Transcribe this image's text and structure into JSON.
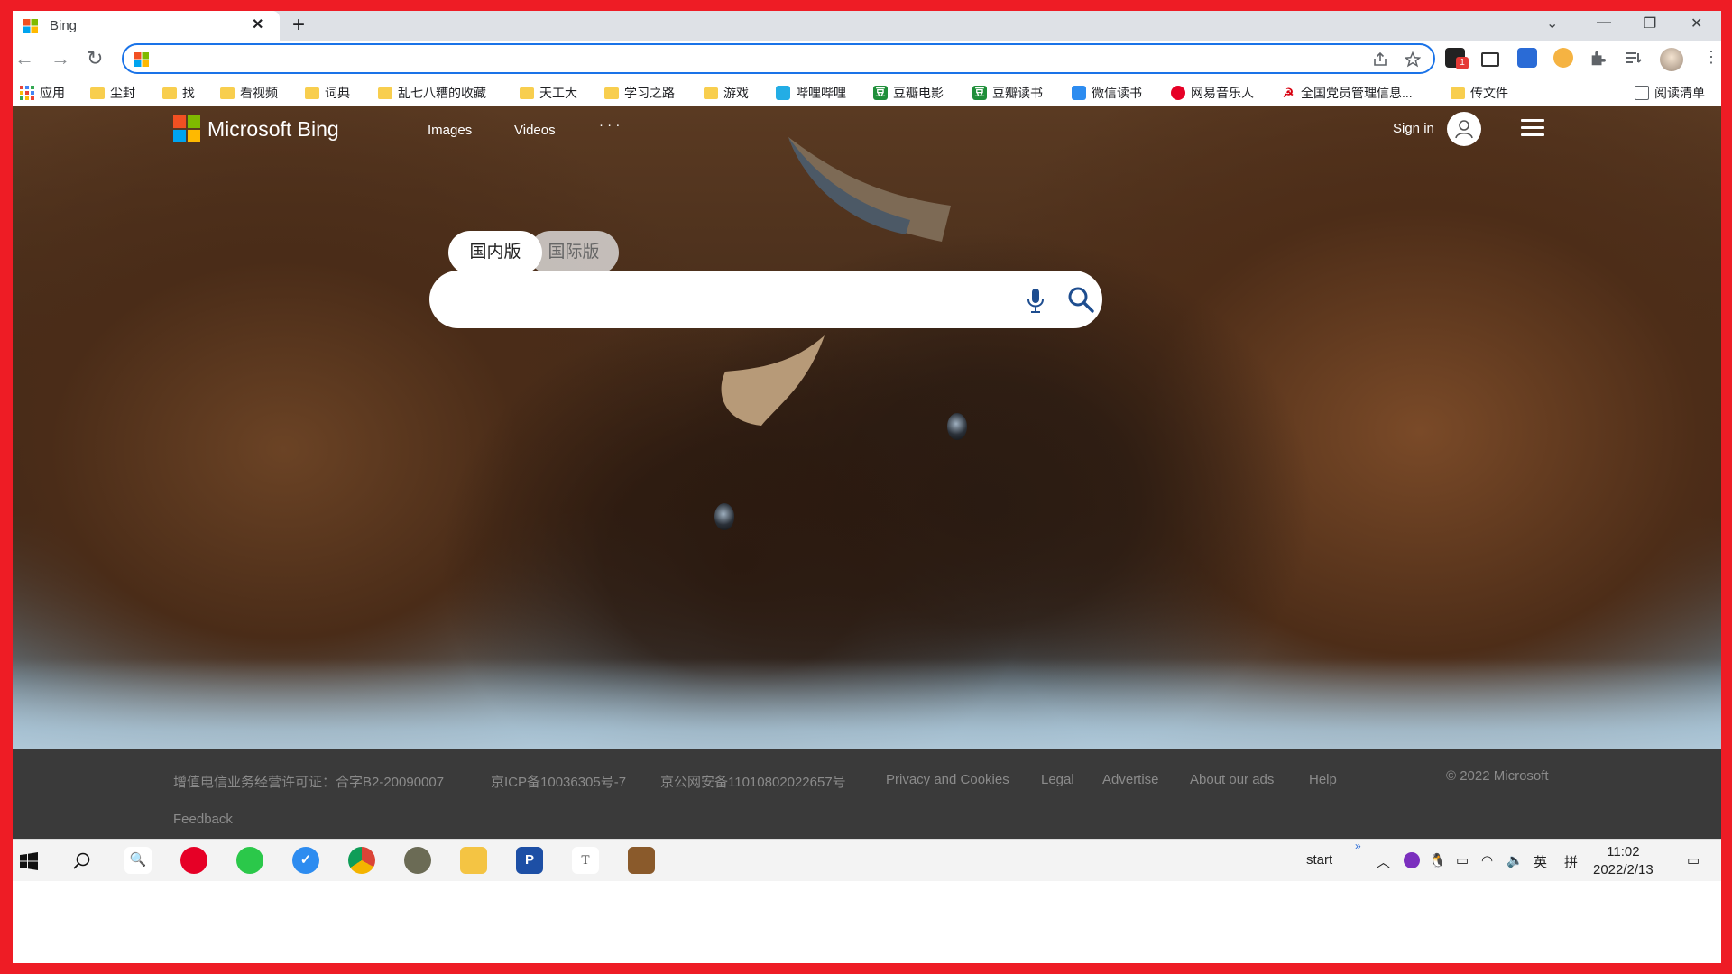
{
  "tab": {
    "title": "Bing",
    "close_symbol": "✕",
    "new_tab_symbol": "+"
  },
  "window_controls": {
    "dropdown": "⌄",
    "minimize": "—",
    "restore": "❐",
    "close": "✕"
  },
  "toolbar": {
    "back_symbol": "←",
    "forward_symbol": "→",
    "reload_symbol": "↻",
    "address_value": ""
  },
  "extensions": {
    "badge_count": "1"
  },
  "bookmarks": [
    {
      "label": "应用",
      "icon": "apps-grid-icon"
    },
    {
      "label": "尘封",
      "icon": "folder-icon"
    },
    {
      "label": "找",
      "icon": "folder-icon"
    },
    {
      "label": "看视频",
      "icon": "folder-icon"
    },
    {
      "label": "词典",
      "icon": "folder-icon"
    },
    {
      "label": "乱七八糟的收藏",
      "icon": "folder-icon"
    },
    {
      "label": "天工大",
      "icon": "folder-icon"
    },
    {
      "label": "学习之路",
      "icon": "folder-icon"
    },
    {
      "label": "游戏",
      "icon": "folder-icon"
    },
    {
      "label": "哔哩哔哩",
      "icon": "bilibili-icon"
    },
    {
      "label": "豆瓣电影",
      "icon": "douban-icon"
    },
    {
      "label": "豆瓣读书",
      "icon": "douban-icon"
    },
    {
      "label": "微信读书",
      "icon": "weread-icon"
    },
    {
      "label": "网易音乐人",
      "icon": "netease-music-icon"
    },
    {
      "label": "全国党员管理信息...",
      "icon": "party-emblem-icon"
    },
    {
      "label": "传文件",
      "icon": "folder-icon"
    }
  ],
  "reading_list": {
    "label": "阅读清单"
  },
  "bing": {
    "logo_text": "Microsoft Bing",
    "nav": [
      "Images",
      "Videos",
      "· · ·"
    ],
    "sign_in": "Sign in",
    "segments": {
      "active": "国内版",
      "inactive": "国际版"
    },
    "search_placeholder": ""
  },
  "footer": {
    "links": [
      "增值电信业务经营许可证：合字B2-20090007",
      "京ICP备10036305号-7",
      "京公网安备11010802022657号",
      "Privacy and Cookies",
      "Legal",
      "Advertise",
      "About our ads",
      "Help"
    ],
    "copyright": "© 2022 Microsoft",
    "feedback": "Feedback"
  },
  "taskbar": {
    "tray_text": "start",
    "tray_chevron": "»",
    "language": "英",
    "ime": "拼",
    "time": "11:02",
    "date": "2022/2/13"
  },
  "colors": {
    "accent": "#1a73e8",
    "frame_border": "#ee1c25",
    "footer_bg": "#3a3a3a"
  }
}
